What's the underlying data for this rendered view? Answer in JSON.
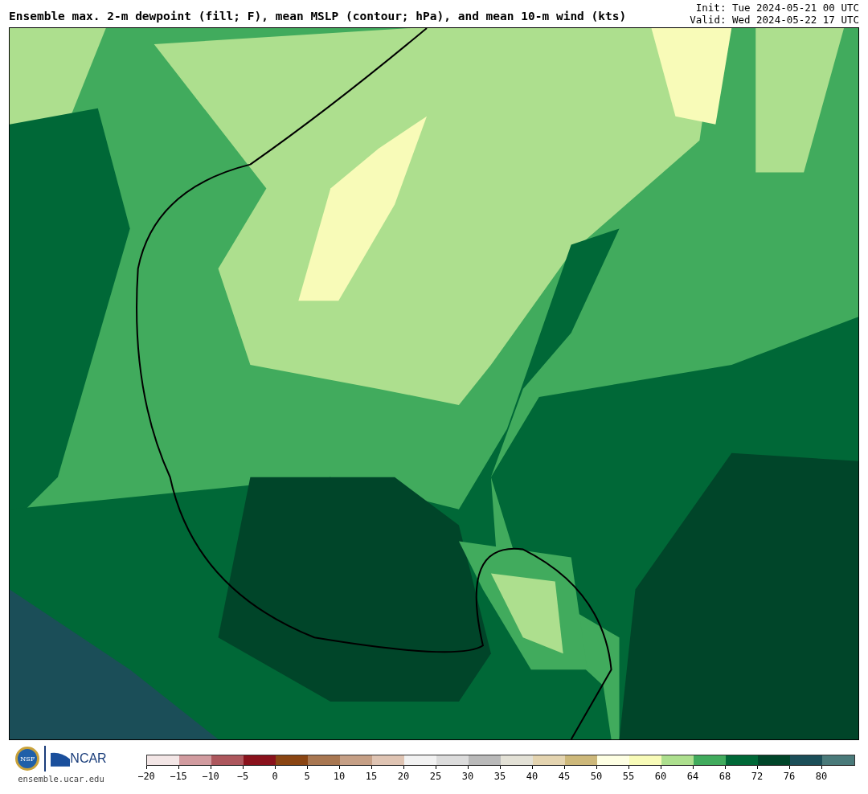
{
  "title": "Ensemble max. 2-m dewpoint (fill; F), mean MSLP (contour; hPa), and mean 10-m wind (kts)",
  "init": "Init: Tue 2024-05-21 00 UTC",
  "valid": "Valid: Wed 2024-05-22 17 UTC",
  "logos": {
    "nsf": "NSF",
    "ncar": "NCAR",
    "site": "ensemble.ucar.edu"
  },
  "colorbar": [
    {
      "color": "#f3e6e6",
      "label": "−20"
    },
    {
      "color": "#d19b9f",
      "label": "−15"
    },
    {
      "color": "#ad575d",
      "label": "−10"
    },
    {
      "color": "#8a121c",
      "label": "−5"
    },
    {
      "color": "#8a4513",
      "label": "0"
    },
    {
      "color": "#a87751",
      "label": "5"
    },
    {
      "color": "#c59f85",
      "label": "10"
    },
    {
      "color": "#dfc4b3",
      "label": "15"
    },
    {
      "color": "#f2f2f2",
      "label": "20"
    },
    {
      "color": "#dcdcdc",
      "label": "25"
    },
    {
      "color": "#b9b9b9",
      "label": "30"
    },
    {
      "color": "#e3e1d6",
      "label": "35"
    },
    {
      "color": "#e4d4b0",
      "label": "40"
    },
    {
      "color": "#cdb87a",
      "label": "45"
    },
    {
      "color": "#feffe3",
      "label": "50"
    },
    {
      "color": "#f8fbb8",
      "label": "55"
    },
    {
      "color": "#addf8e",
      "label": "60"
    },
    {
      "color": "#41ab5d",
      "label": "64"
    },
    {
      "color": "#006837",
      "label": "68"
    },
    {
      "color": "#004529",
      "label": "72"
    },
    {
      "color": "#1b4e58",
      "label": "76"
    },
    {
      "color": "#4a7a7a",
      "label": "80"
    }
  ]
}
